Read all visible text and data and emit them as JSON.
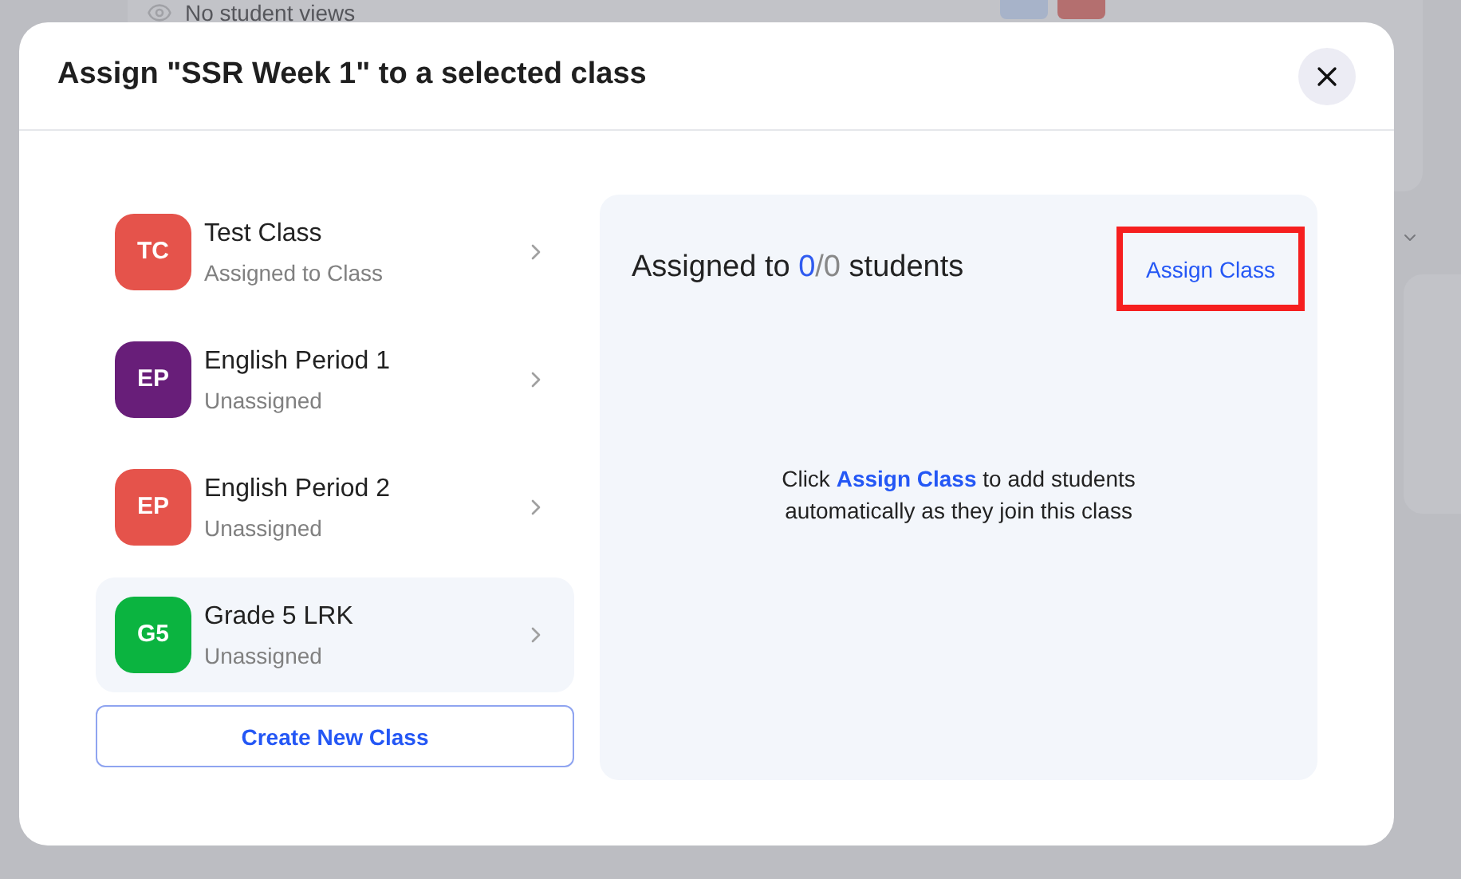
{
  "background": {
    "views_label": "No student views"
  },
  "dialog": {
    "title": "Assign \"SSR Week 1\" to a selected class",
    "classes": [
      {
        "initials": "TC",
        "name": "Test Class",
        "status": "Assigned to Class",
        "color": "#e5534b",
        "selected": false
      },
      {
        "initials": "EP",
        "name": "English Period 1",
        "status": "Unassigned",
        "color": "#681e79",
        "selected": false
      },
      {
        "initials": "EP",
        "name": "English Period 2",
        "status": "Unassigned",
        "color": "#e5534b",
        "selected": false
      },
      {
        "initials": "G5",
        "name": "Grade 5 LRK",
        "status": "Unassigned",
        "color": "#0bb440",
        "selected": true
      }
    ],
    "create_button": "Create New Class",
    "panel": {
      "heading_prefix": "Assigned to",
      "assigned": "0",
      "total": "/0",
      "heading_suffix": "students",
      "assign_button": {
        "label": "Assign Class",
        "highlighted": true
      },
      "hint": {
        "before": "Click",
        "link": "Assign Class",
        "after": "to add students automatically as they join this class"
      }
    }
  }
}
